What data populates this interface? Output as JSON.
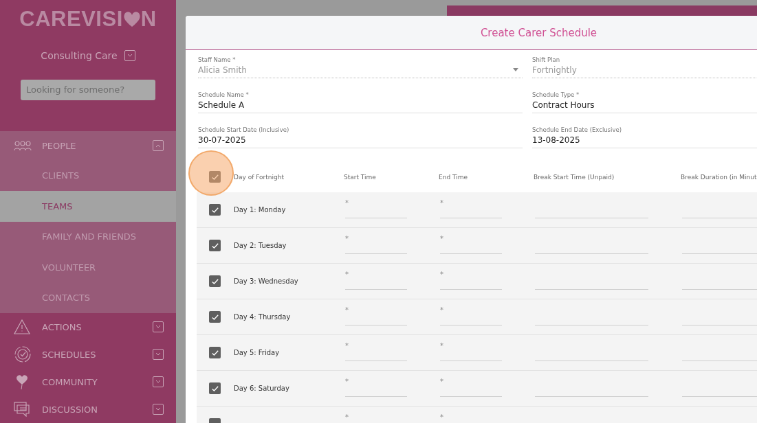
{
  "sidebar": {
    "logo": {
      "before": "CAREVISI",
      "after": "N"
    },
    "organisation": "Consulting Care",
    "search": {
      "placeholder": "Looking for someone?"
    },
    "nav": [
      {
        "label": "PEOPLE",
        "expanded": true,
        "children": [
          {
            "label": "CLIENTS",
            "selected": false
          },
          {
            "label": "TEAMS",
            "selected": true
          },
          {
            "label": "FAMILY AND FRIENDS",
            "selected": false
          },
          {
            "label": "VOLUNTEER",
            "selected": false
          },
          {
            "label": "CONTACTS",
            "selected": false
          }
        ]
      },
      {
        "label": "ACTIONS",
        "expanded": false
      },
      {
        "label": "SCHEDULES",
        "expanded": false
      },
      {
        "label": "COMMUNITY",
        "expanded": false
      },
      {
        "label": "DISCUSSION",
        "expanded": false
      }
    ]
  },
  "dialog": {
    "title": "Create Carer Schedule",
    "fields": [
      {
        "label": "Staff Name *",
        "value": "Alicia Smith",
        "kind": "select",
        "disabled": true
      },
      {
        "label": "Shift Plan",
        "value": "Fortnightly",
        "kind": "text",
        "disabled": true
      },
      {
        "label": "Schedule Name *",
        "value": "Schedule A",
        "kind": "text",
        "disabled": false
      },
      {
        "label": "Schedule Type *",
        "value": "Contract Hours",
        "kind": "text",
        "disabled": false
      },
      {
        "label": "Schedule Start Date (Inclusive)",
        "value": "30-07-2025",
        "kind": "date",
        "disabled": false
      },
      {
        "label": "Schedule End Date (Exclusive)",
        "value": "13-08-2025",
        "kind": "date",
        "disabled": false
      }
    ],
    "table": {
      "all_checked": true,
      "highlighted": true,
      "columns": [
        "Day of Fortnight",
        "Start Time",
        "End Time",
        "Break Start Time (Unpaid)",
        "Break Duration (in Minut"
      ],
      "rows": [
        {
          "checked": true,
          "day": "Day 1: Monday",
          "start": "*",
          "end": "*"
        },
        {
          "checked": true,
          "day": "Day 2: Tuesday",
          "start": "*",
          "end": "*"
        },
        {
          "checked": true,
          "day": "Day 3: Wednesday",
          "start": "*",
          "end": "*"
        },
        {
          "checked": true,
          "day": "Day 4: Thursday",
          "start": "*",
          "end": "*"
        },
        {
          "checked": true,
          "day": "Day 5: Friday",
          "start": "*",
          "end": "*"
        },
        {
          "checked": true,
          "day": "Day 6: Saturday",
          "start": "*",
          "end": "*"
        },
        {
          "checked": true,
          "start": "*",
          "end": "*"
        }
      ]
    }
  }
}
